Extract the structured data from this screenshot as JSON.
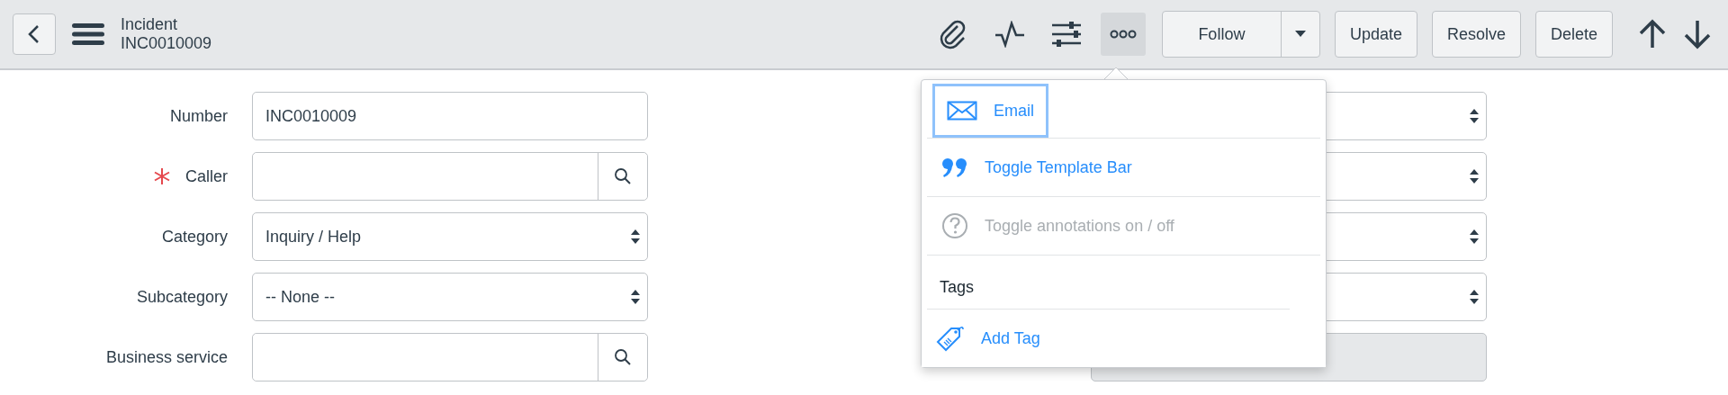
{
  "header": {
    "title": "Incident",
    "subtitle": "INC0010009"
  },
  "icon_buttons": [
    {
      "selected": false
    },
    {
      "selected": false
    },
    {
      "selected": false
    },
    {
      "selected": true
    }
  ],
  "buttons": [
    {
      "label": "Follow",
      "kind": "split"
    },
    {
      "label": "Update",
      "kind": "plain"
    },
    {
      "label": "Resolve",
      "kind": "plain"
    },
    {
      "label": "Delete",
      "kind": "plain"
    }
  ],
  "fields": [
    {
      "label": "Number",
      "kind": "text",
      "value": "INC0010009",
      "required": false
    },
    {
      "label": "Caller",
      "kind": "lookup",
      "required": true
    },
    {
      "label": "Category",
      "kind": "select",
      "value": "Inquiry / Help",
      "required": false
    },
    {
      "label": "Subcategory",
      "kind": "select",
      "value": "-- None --",
      "required": false
    },
    {
      "label": "Business service",
      "kind": "lookup",
      "required": false
    }
  ],
  "right_fields": [
    {
      "kind": "select"
    },
    {
      "kind": "select"
    },
    {
      "kind": "select"
    },
    {
      "kind": "select"
    },
    {
      "kind": "readonly"
    }
  ],
  "menu": {
    "items": [
      {
        "kind": "action",
        "label": "Email",
        "focused": true,
        "disabled": false
      },
      {
        "kind": "action",
        "label": "Toggle Template Bar",
        "focused": false,
        "disabled": false
      },
      {
        "kind": "action",
        "label": "Toggle annotations on / off",
        "focused": false,
        "disabled": true
      },
      {
        "kind": "header",
        "label": "Tags"
      },
      {
        "kind": "action",
        "label": "Add Tag",
        "focused": false,
        "disabled": false
      }
    ]
  }
}
